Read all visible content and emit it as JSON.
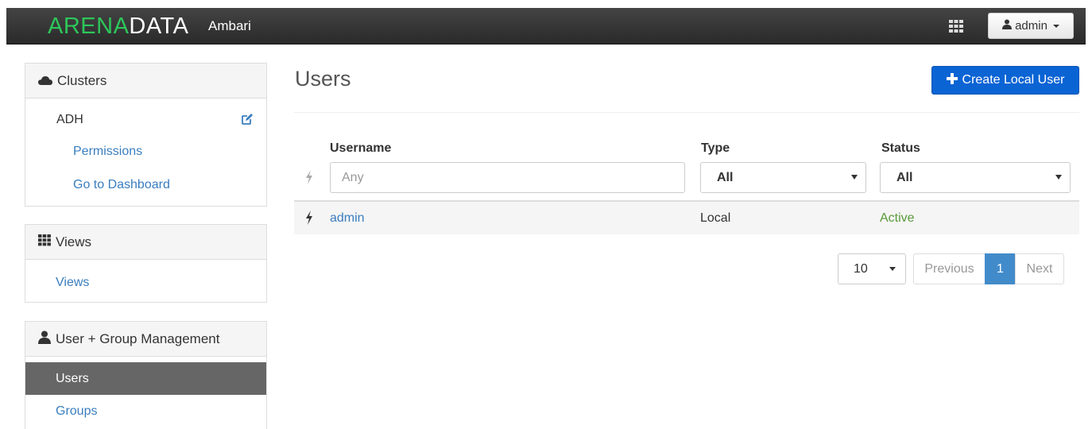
{
  "navbar": {
    "brand_part1": "ARENA",
    "brand_part2": "DATA",
    "app_name": "Ambari",
    "user_label": "admin",
    "brand_color": "#2dc65a"
  },
  "sidebar": {
    "clusters": {
      "heading": "Clusters",
      "icon": "cloud-icon",
      "cluster_name": "ADH",
      "links": [
        "Permissions",
        "Go to Dashboard"
      ]
    },
    "views": {
      "heading": "Views",
      "icon": "grid-icon",
      "links": [
        "Views"
      ]
    },
    "user_mgmt": {
      "heading": "User + Group Management",
      "icon": "user-icon",
      "items": [
        "Users",
        "Groups"
      ],
      "active": "Users"
    }
  },
  "main": {
    "title": "Users",
    "create_button": "Create Local User",
    "columns": [
      "Username",
      "Type",
      "Status"
    ],
    "filters": {
      "username_placeholder": "Any",
      "type_value": "All",
      "status_value": "All"
    },
    "rows": [
      {
        "username": "admin",
        "type": "Local",
        "status": "Active"
      }
    ],
    "pagination": {
      "page_size": "10",
      "previous": "Previous",
      "current": "1",
      "next": "Next"
    },
    "colors": {
      "link": "#3a7ebf",
      "primary": "#0b64d4",
      "status_active": "#5a9a3a"
    }
  }
}
